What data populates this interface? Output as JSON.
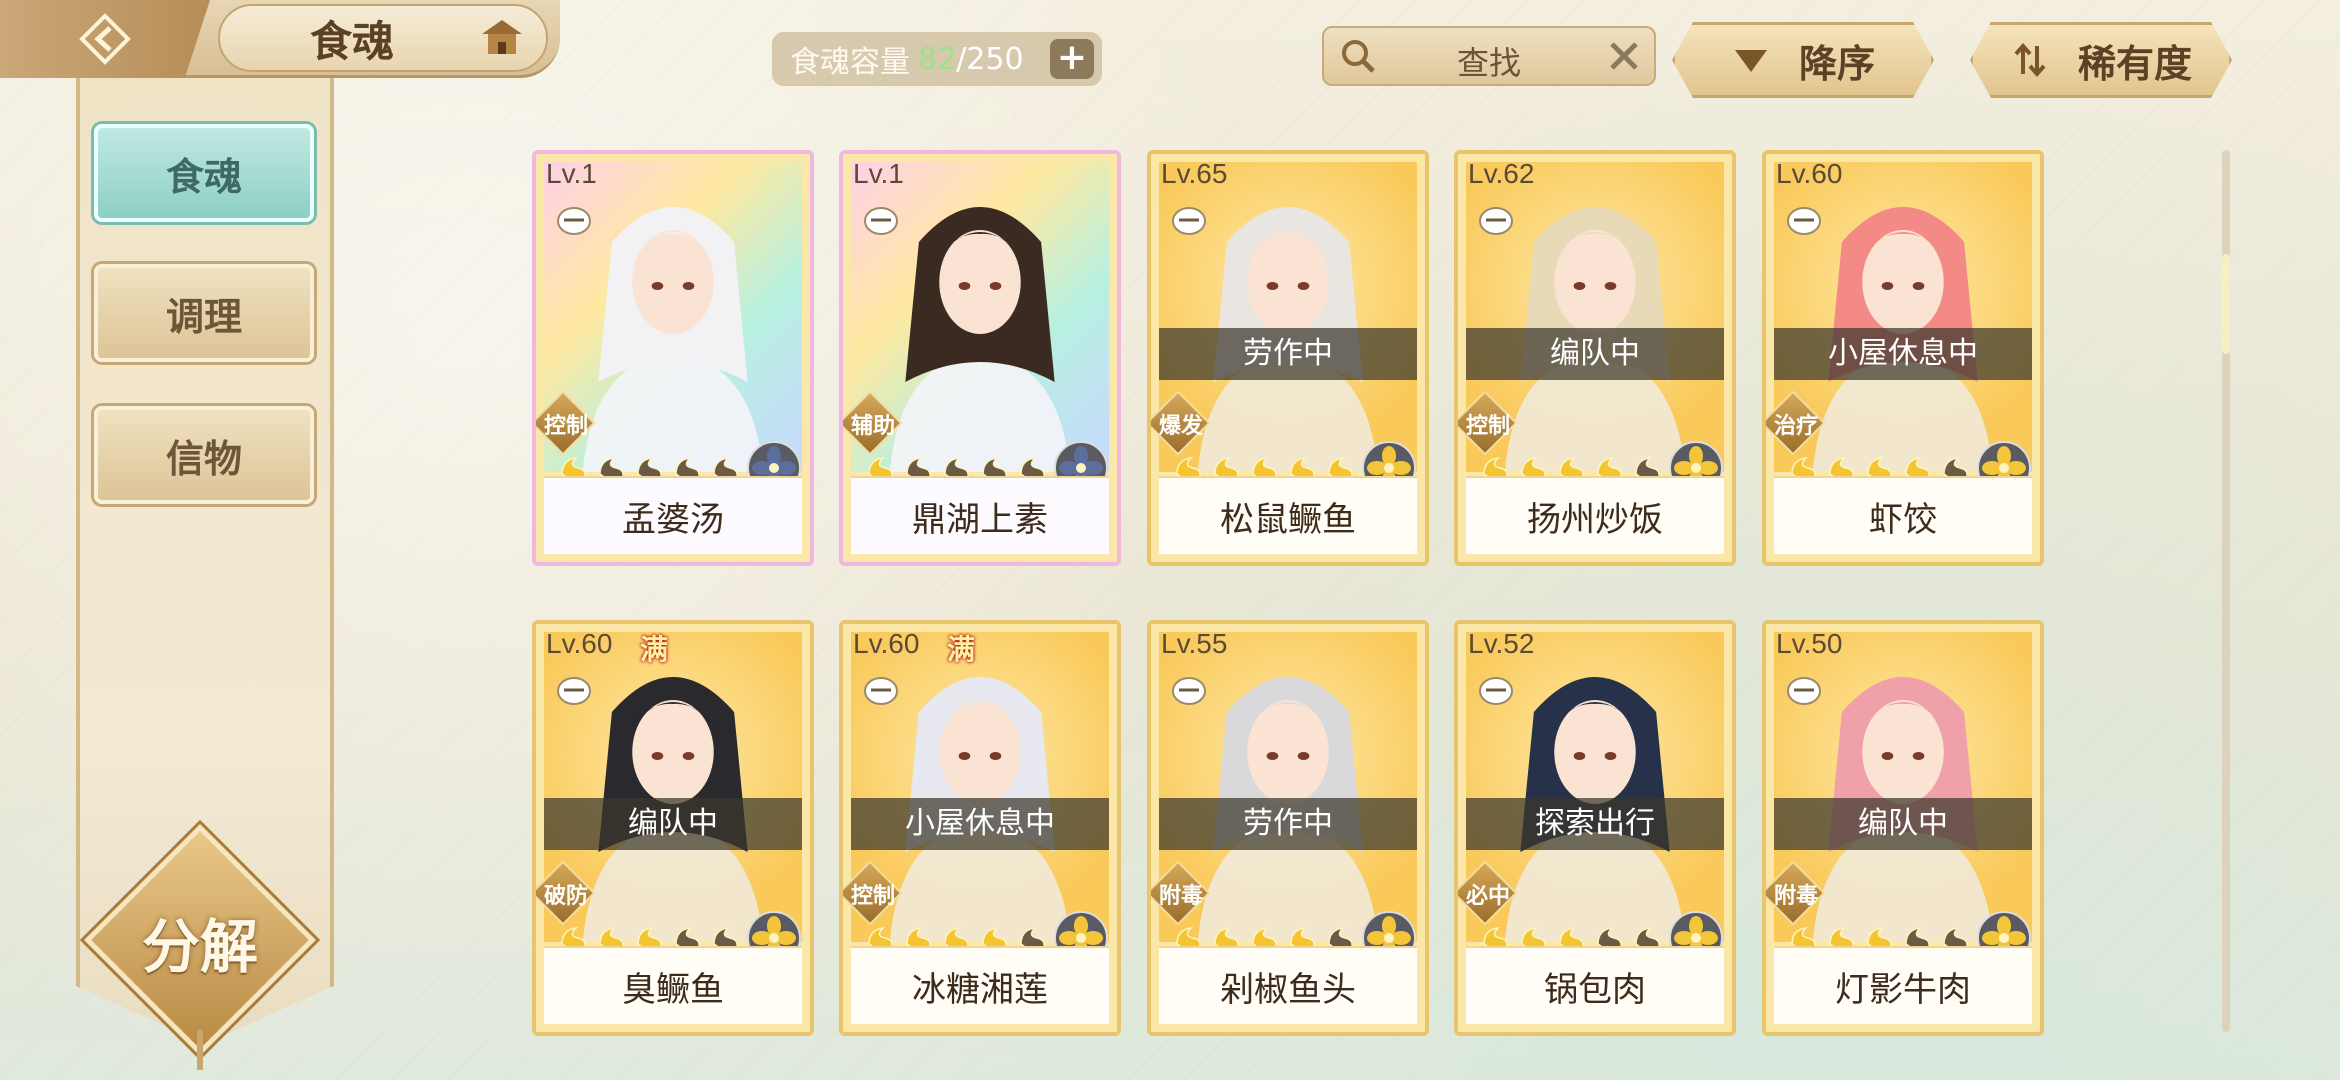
{
  "header": {
    "title": "食魂",
    "capacity": {
      "label": "食魂容量",
      "current": "82",
      "sep": "/",
      "max": "250",
      "plus": "+"
    },
    "search": {
      "placeholder": "查找"
    },
    "sort_order_label": "降序",
    "sort_rarity_label": "稀有度"
  },
  "sidebar": {
    "tabs": [
      {
        "label": "食魂",
        "active": true
      },
      {
        "label": "调理",
        "active": false
      },
      {
        "label": "信物",
        "active": false
      }
    ],
    "decompose_label": "分解"
  },
  "scroll": {
    "position": 0.12
  },
  "cards": [
    {
      "level": "Lv.1",
      "name": "孟婆汤",
      "role": "控制",
      "status": "",
      "full": "",
      "stars": 5,
      "filled": 1,
      "rarity": "rainbow",
      "hair": "#f2f2f5",
      "element": "water"
    },
    {
      "level": "Lv.1",
      "name": "鼎湖上素",
      "role": "辅助",
      "status": "",
      "full": "",
      "stars": 6,
      "filled": 1,
      "rarity": "rainbow",
      "hair": "#3b2a22",
      "element": "water"
    },
    {
      "level": "Lv.65",
      "name": "松鼠鳜鱼",
      "role": "爆发",
      "status": "劳作中",
      "full": "",
      "stars": 5,
      "filled": 5,
      "rarity": "gold",
      "hair": "#e9e6e2",
      "element": "gold"
    },
    {
      "level": "Lv.62",
      "name": "扬州炒饭",
      "role": "控制",
      "status": "编队中",
      "full": "",
      "stars": 5,
      "filled": 4,
      "rarity": "gold",
      "hair": "#e8dab7",
      "element": "gold"
    },
    {
      "level": "Lv.60",
      "name": "虾饺",
      "role": "治疗",
      "status": "小屋休息中",
      "full": "",
      "stars": 5,
      "filled": 4,
      "rarity": "gold",
      "hair": "#f48a86",
      "element": "gold"
    },
    {
      "level": "Lv.60",
      "name": "臭鳜鱼",
      "role": "破防",
      "status": "编队中",
      "full": "满",
      "stars": 5,
      "filled": 3,
      "rarity": "gold",
      "hair": "#2a2a2e",
      "element": "gold"
    },
    {
      "level": "Lv.60",
      "name": "冰糖湘莲",
      "role": "控制",
      "status": "小屋休息中",
      "full": "满",
      "stars": 5,
      "filled": 4,
      "rarity": "gold",
      "hair": "#e8e8f0",
      "element": "gold"
    },
    {
      "level": "Lv.55",
      "name": "剁椒鱼头",
      "role": "附毒",
      "status": "劳作中",
      "full": "",
      "stars": 5,
      "filled": 4,
      "rarity": "gold",
      "hair": "#d9d9dc",
      "element": "gold"
    },
    {
      "level": "Lv.52",
      "name": "锅包肉",
      "role": "必中",
      "status": "探索出行",
      "full": "",
      "stars": 5,
      "filled": 3,
      "rarity": "gold",
      "hair": "#27314a",
      "element": "gold"
    },
    {
      "level": "Lv.50",
      "name": "灯影牛肉",
      "role": "附毒",
      "status": "编队中",
      "full": "",
      "stars": 5,
      "filled": 3,
      "rarity": "gold",
      "hair": "#f0a0a8",
      "element": "gold"
    }
  ]
}
